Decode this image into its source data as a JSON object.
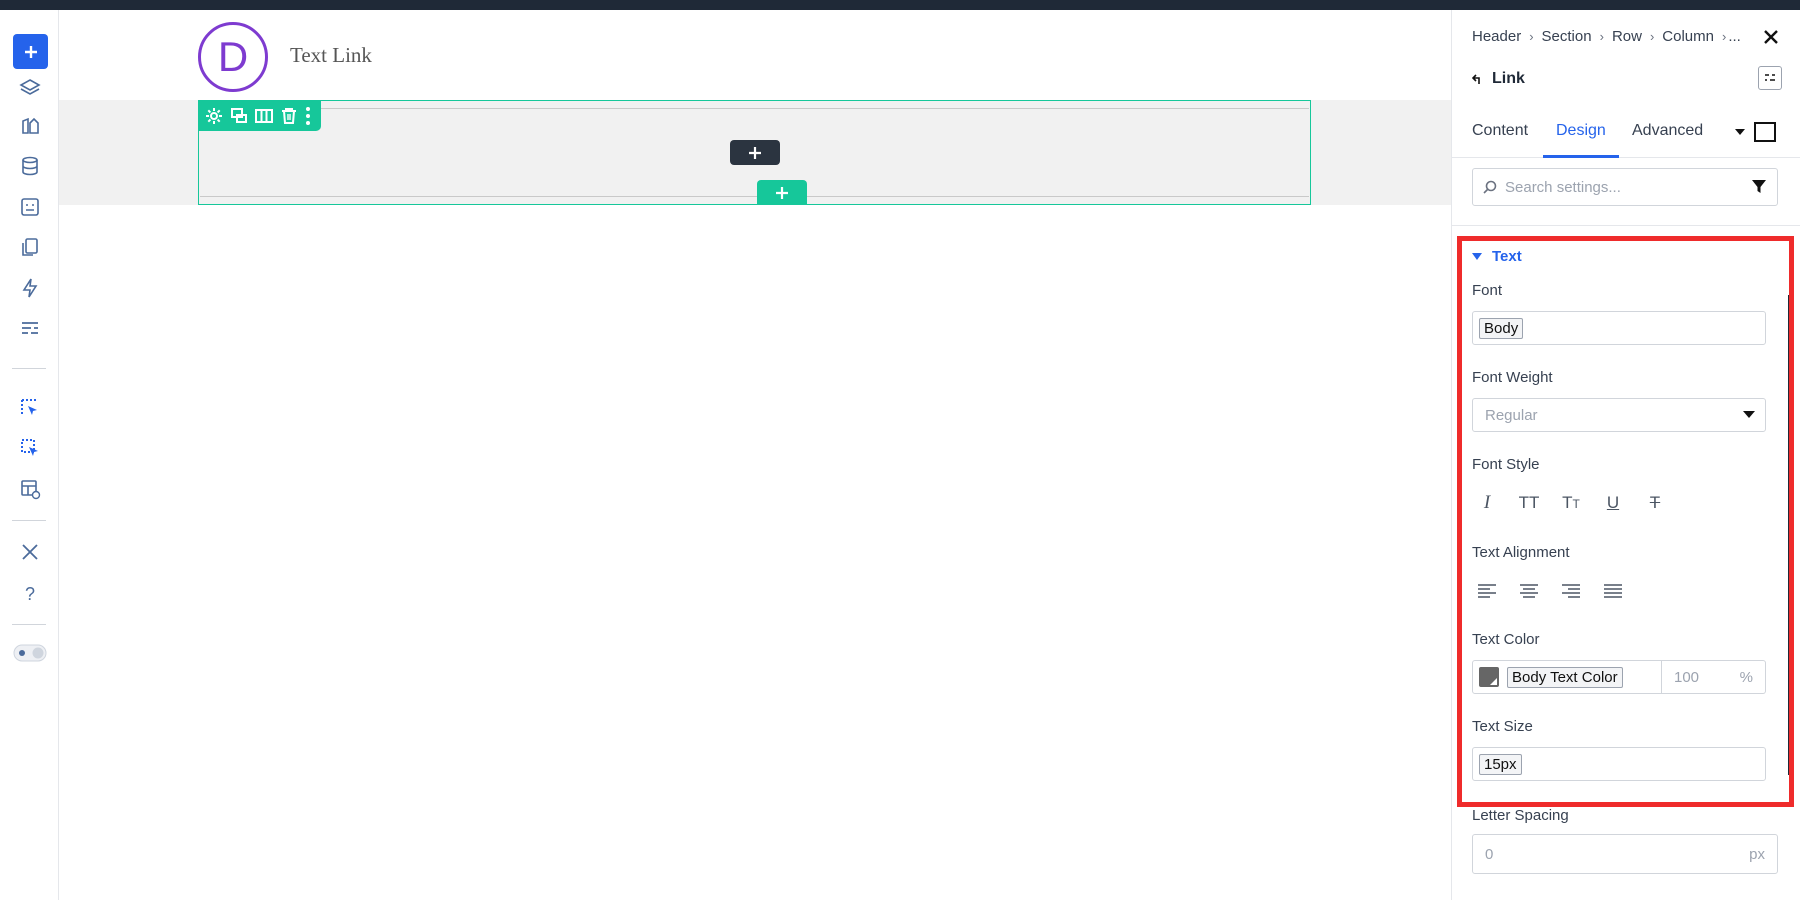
{
  "canvas": {
    "logo_letter": "D",
    "title": "Text Link"
  },
  "panel": {
    "breadcrumbs": [
      "Header",
      "Section",
      "Row",
      "Column",
      "..."
    ],
    "element_name": "Link",
    "tabs": [
      "Content",
      "Design",
      "Advanced"
    ],
    "active_tab": "Design",
    "search_placeholder": "Search settings...",
    "group_title": "Text",
    "font_label": "Font",
    "font_value": "Body",
    "font_weight_label": "Font Weight",
    "font_weight_value": "Regular",
    "font_style_label": "Font Style",
    "font_style_icons": [
      "italic-icon",
      "uppercase-icon",
      "capitalize-icon",
      "underline-icon",
      "strikethrough-icon"
    ],
    "text_alignment_label": "Text Alignment",
    "text_color_label": "Text Color",
    "text_color_value": "Body Text Color",
    "text_color_opacity": "100",
    "text_color_unit": "%",
    "text_size_label": "Text Size",
    "text_size_value": "15px",
    "letter_spacing_label": "Letter Spacing",
    "letter_spacing_value": "0",
    "letter_spacing_unit": "px"
  },
  "colors": {
    "accent": "#2563eb",
    "builder_green": "#16c79a",
    "highlight": "#ef2b2b",
    "logo_purple": "#7e3bd0"
  }
}
